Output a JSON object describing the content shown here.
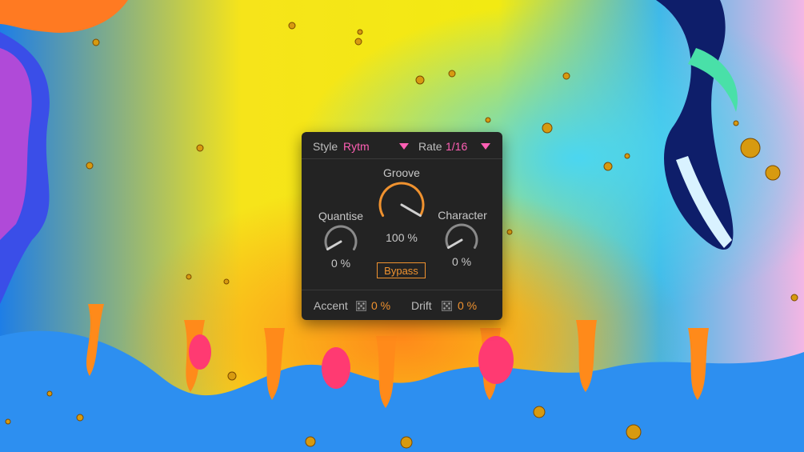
{
  "device": {
    "style": {
      "label": "Style",
      "value": "Rytm"
    },
    "rate": {
      "label": "Rate",
      "value": "1/16"
    },
    "groove": {
      "label": "Groove",
      "value": "100 %",
      "level": 1.0
    },
    "quantise": {
      "label": "Quantise",
      "value": "0 %",
      "level": 0.0
    },
    "character": {
      "label": "Character",
      "value": "0 %",
      "level": 0.0
    },
    "bypass_label": "Bypass",
    "accent": {
      "label": "Accent",
      "value": "0 %"
    },
    "drift": {
      "label": "Drift",
      "value": "0 %"
    }
  },
  "colors": {
    "panel": "#232323",
    "accent_pink": "#ff5fb4",
    "accent_orange": "#f0922f",
    "text": "#bdbdbd"
  },
  "icons": [
    "dropdown-arrow-icon",
    "dice-icon"
  ]
}
